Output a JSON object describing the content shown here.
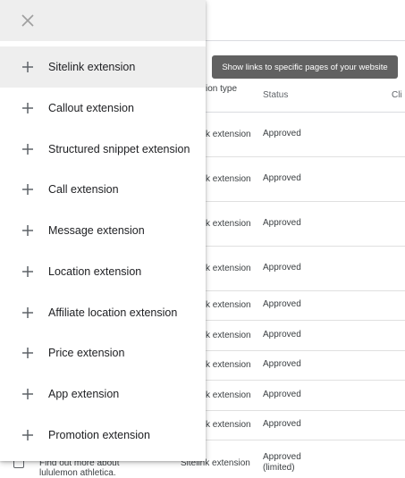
{
  "tooltip": "Show links to specific pages of your website",
  "table": {
    "headers": {
      "type": "ion type",
      "status": "Status",
      "clicks": "Cli"
    },
    "rows": [
      {
        "type": "k extension",
        "status": "Approved"
      },
      {
        "type": "k extension",
        "status": "Approved"
      },
      {
        "type": "k extension",
        "status": "Approved"
      },
      {
        "type": "k extension",
        "status": "Approved"
      },
      {
        "type": "k extension",
        "status": "Approved"
      },
      {
        "type": "k extension",
        "status": "Approved"
      },
      {
        "type": "k extension",
        "status": "Approved"
      },
      {
        "type": "k extension",
        "status": "Approved"
      },
      {
        "type": "k extension",
        "status": "Approved"
      }
    ],
    "last_row": {
      "text_line1": "Find out more about",
      "text_line2": "lululemon athletica.",
      "type": "Sitelink extension",
      "status_line1": "Approved",
      "status_line2": "(limited)"
    }
  },
  "menu": {
    "items": [
      {
        "label": "Sitelink extension"
      },
      {
        "label": "Callout extension"
      },
      {
        "label": "Structured snippet extension"
      },
      {
        "label": "Call extension"
      },
      {
        "label": "Message extension"
      },
      {
        "label": "Location extension"
      },
      {
        "label": "Affiliate location extension"
      },
      {
        "label": "Price extension"
      },
      {
        "label": "App extension"
      },
      {
        "label": "Promotion extension"
      }
    ]
  },
  "icons": {
    "close": "close-icon",
    "add": "plus-icon"
  },
  "colors": {
    "panel_header_bg": "#eeeeee",
    "active_item_bg": "#eeeeee",
    "tooltip_bg": "#616161",
    "icon_gray": "#5f6368"
  }
}
